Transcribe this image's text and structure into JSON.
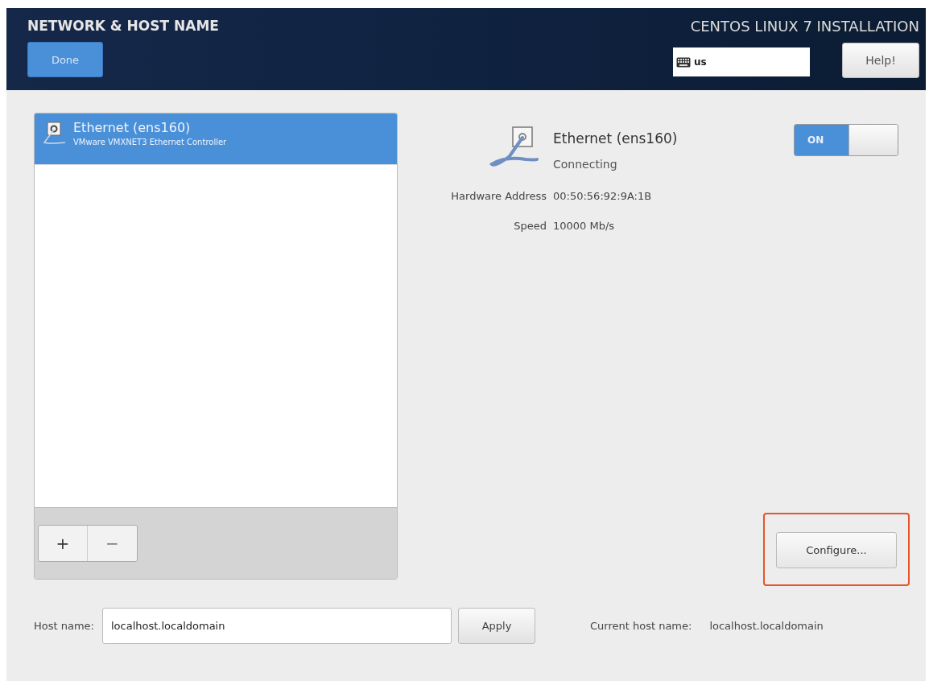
{
  "header": {
    "title": "NETWORK & HOST NAME",
    "done_button": "Done",
    "product": "CENTOS LINUX 7 INSTALLATION",
    "keyboard_layout": "us",
    "help_button": "Help!"
  },
  "devices": [
    {
      "name": "Ethernet (ens160)",
      "description": "VMware VMXNET3 Ethernet Controller",
      "selected": true
    }
  ],
  "device_toolbar": [
    "+",
    "−"
  ],
  "detail": {
    "name": "Ethernet (ens160)",
    "status": "Connecting",
    "switch": {
      "label": "ON",
      "on": true
    },
    "properties": [
      {
        "label": "Hardware Address",
        "value": "00:50:56:92:9A:1B"
      },
      {
        "label": "Speed",
        "value": "10000 Mb/s"
      }
    ],
    "configure_button": "Configure...",
    "configure_highlighted": true
  },
  "host": {
    "label": "Host name:",
    "value": "localhost.localdomain",
    "apply_button": "Apply",
    "current_label": "Current host name:",
    "current_value": "localhost.localdomain"
  }
}
